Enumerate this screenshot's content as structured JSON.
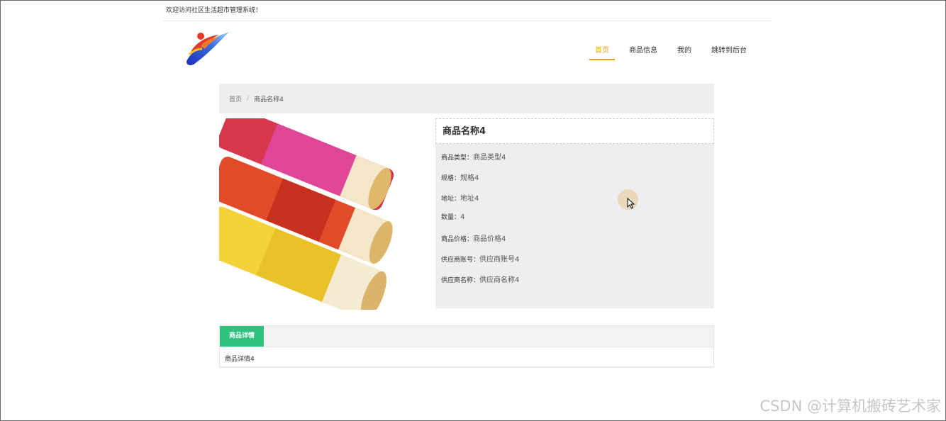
{
  "header": {
    "welcome_text": "欢迎访问社区生活超市管理系统！"
  },
  "nav": {
    "items": [
      {
        "label": "首页",
        "active": true
      },
      {
        "label": "商品信息",
        "active": false
      },
      {
        "label": "我的",
        "active": false
      },
      {
        "label": "跳转到后台",
        "active": false
      }
    ]
  },
  "breadcrumb": {
    "home": "首页",
    "separator": "/",
    "current": "商品名称4"
  },
  "product": {
    "title": "商品名称4",
    "fields": [
      {
        "label": "商品类型：",
        "value": "商品类型4"
      },
      {
        "label": "规格：",
        "value": "规格4"
      },
      {
        "label": "地址：",
        "value": "地址4"
      },
      {
        "label": "数量：",
        "value": "4"
      },
      {
        "label": "商品价格：",
        "value": "商品价格4"
      },
      {
        "label": "供应商账号：",
        "value": "供应商账号4"
      },
      {
        "label": "供应商名称：",
        "value": "供应商名称4"
      }
    ]
  },
  "details": {
    "tab_label": "商品详情",
    "content": "商品详情4"
  },
  "watermark": "CSDN @计算机搬砖艺术家",
  "colors": {
    "accent": "#e8a317",
    "tab_green": "#2ec27e",
    "panel_bg": "#eeeef0"
  }
}
